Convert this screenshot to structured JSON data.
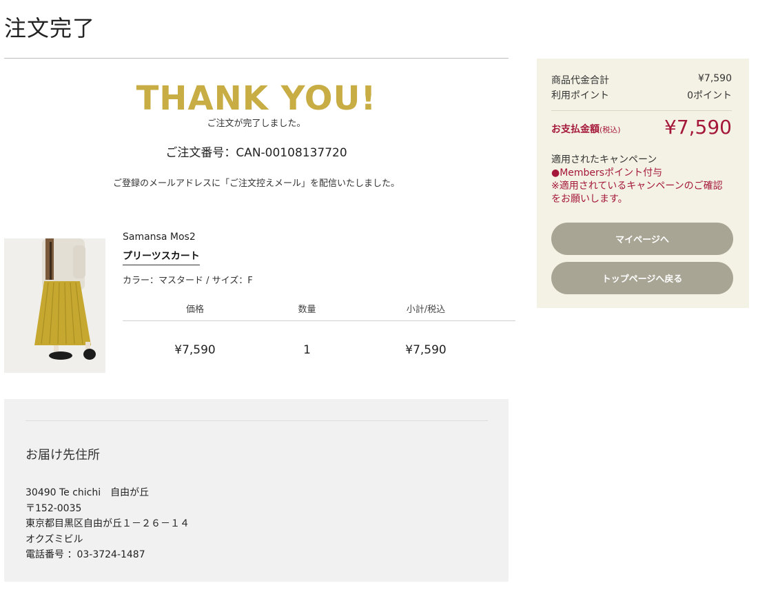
{
  "header": {
    "title": "注文完了"
  },
  "thanks": {
    "headline": "THANK YOU!",
    "message": "ご注文が完了しました。",
    "order_number": "ご注文番号：CAN-00108137720",
    "mail_note": "ご登録のメールアドレスに「ご注文控えメール」を配信いたしました。"
  },
  "product": {
    "brand": "Samansa Mos2",
    "name": "プリーツスカート",
    "variant": "カラー：マスタード / サイズ：F",
    "image_icon": "product-photo-skirt",
    "table": {
      "headers": [
        "価格",
        "数量",
        "小計/税込"
      ],
      "values": [
        "¥7,590",
        "1",
        "¥7,590"
      ]
    }
  },
  "address": {
    "heading": "お届け先住所",
    "lines": [
      "30490 Te chichi　自由が丘",
      "〒152-0035",
      "東京都目黒区自由が丘１－２６－１４",
      "オクズミビル",
      "電話番号 ：03-3724-1487"
    ]
  },
  "summary": {
    "subtotal_label": "商品代金合計",
    "subtotal_value": "¥7,590",
    "points_label": "利用ポイント",
    "points_value": "0ポイント",
    "payment_label": "お支払金額",
    "payment_tax": "(税込)",
    "payment_value": "¥7,590",
    "campaign_title": "適用されたキャンペーン",
    "campaign_lines": [
      "●Membersポイント付与",
      "※適用されているキャンペーンのご確認",
      "をお願いします。"
    ],
    "mypage_button": "マイページへ",
    "top_button": "トップページへ戻る"
  },
  "colors": {
    "accent_gold": "#c8ad44",
    "price_red": "#a4173a",
    "summary_bg": "#f4f2e4",
    "button_bg": "#a8a594"
  }
}
